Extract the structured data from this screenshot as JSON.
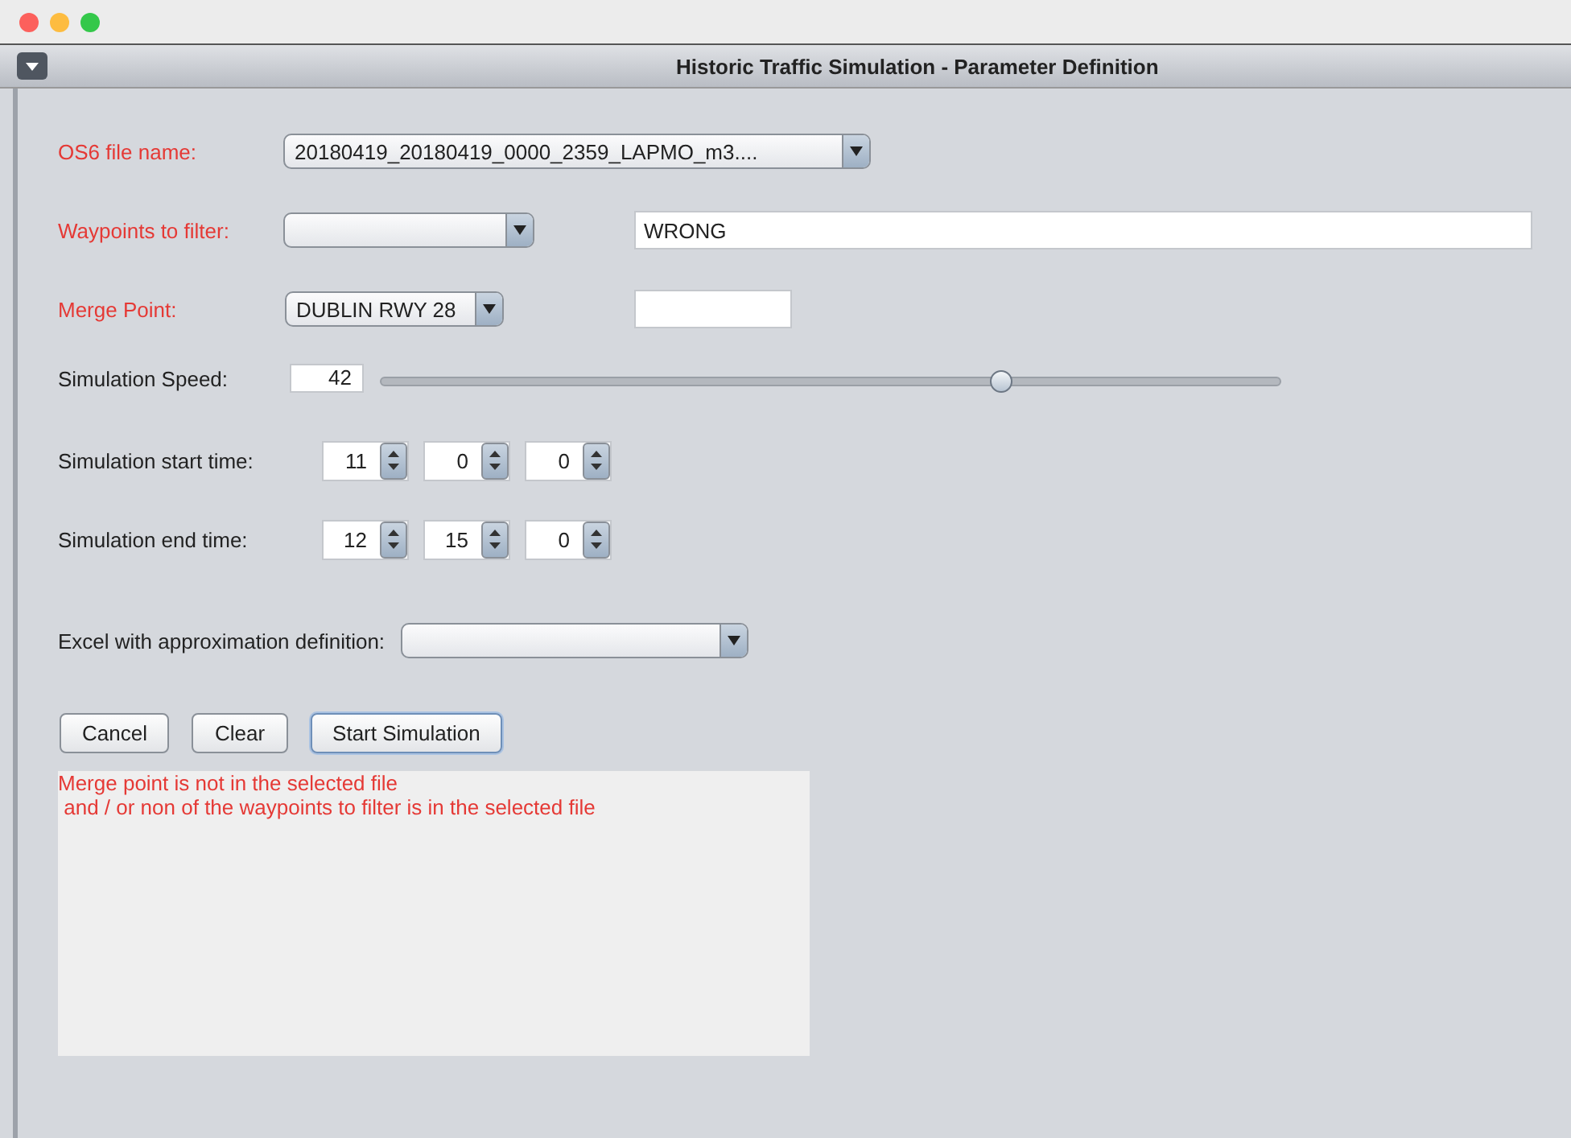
{
  "window": {
    "title": "Historic Traffic Simulation - Parameter Definition"
  },
  "file_name": {
    "label": "OS6 file name:",
    "error": true,
    "value": "20180419_20180419_0000_2359_LAPMO_m3...."
  },
  "waypoints": {
    "label": "Waypoints to filter:",
    "error": true,
    "text_value": "WRONG"
  },
  "merge_point": {
    "label": "Merge Point:",
    "error": true,
    "value": "DUBLIN RWY 28"
  },
  "speed": {
    "label": "Simulation Speed:",
    "value": "42",
    "level": 0.69
  },
  "start_time": {
    "label": "Simulation start time:",
    "parts": [
      "11",
      "0",
      "0"
    ]
  },
  "end_time": {
    "label": "Simulation end time:",
    "parts": [
      "12",
      "15",
      "0"
    ]
  },
  "excel": {
    "label": "Excel with approximation definition:"
  },
  "buttons": [
    {
      "label": "Cancel",
      "default": false
    },
    {
      "label": "Clear",
      "default": false
    },
    {
      "label": "Start Simulation",
      "default": true
    }
  ],
  "message": {
    "error": true,
    "lines": [
      "Merge point is not in the selected file",
      " and / or non of the waypoints to filter is in the selected file"
    ]
  }
}
